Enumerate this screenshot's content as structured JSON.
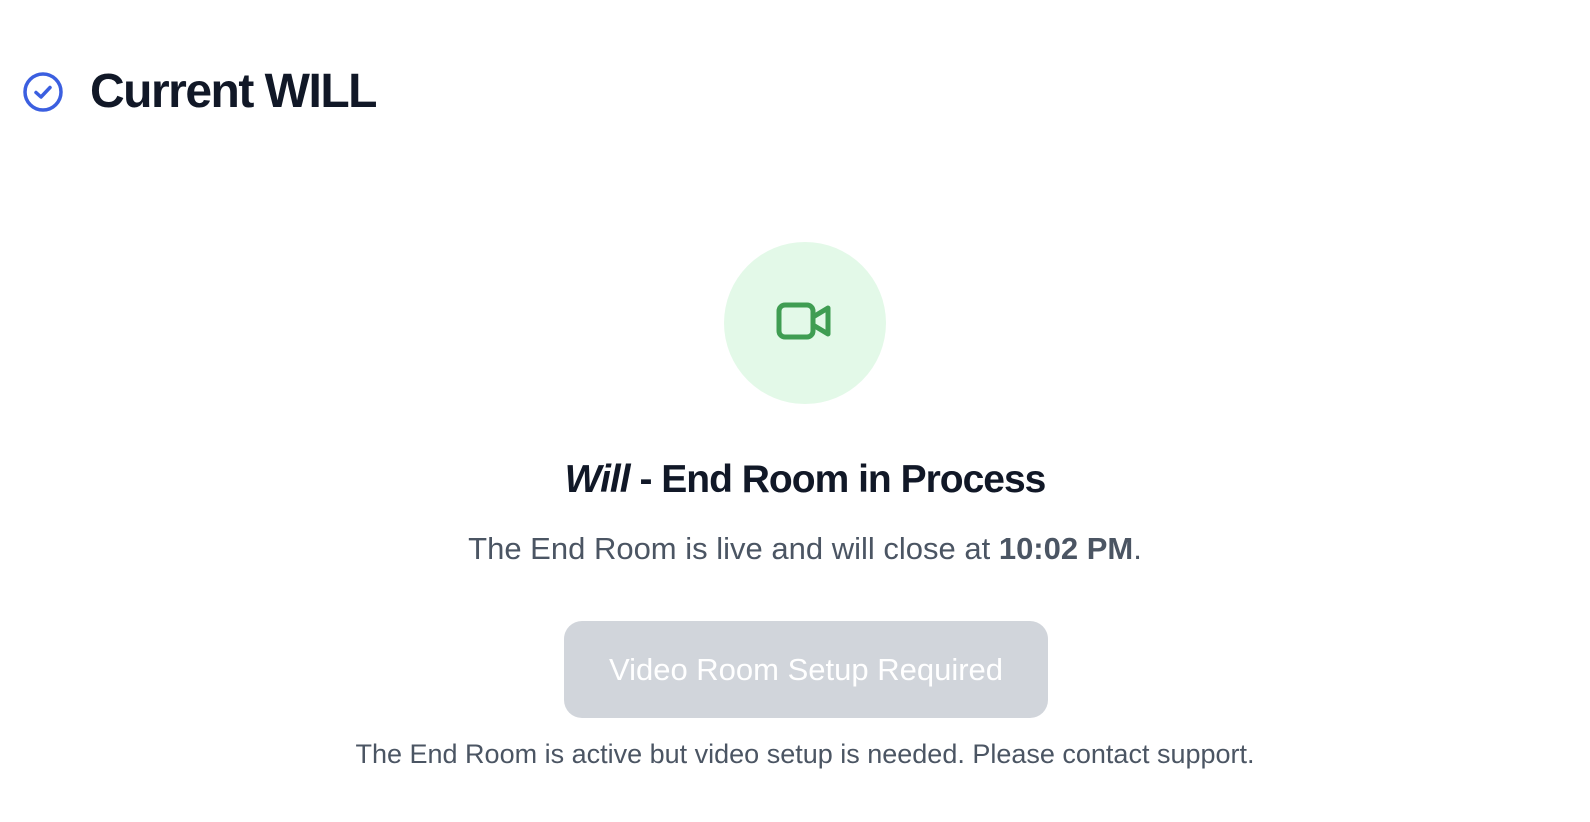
{
  "header": {
    "title": "Current WILL",
    "icon": "check-circle-icon",
    "icon_color": "#3b5fe0"
  },
  "room": {
    "icon": "video-camera-icon",
    "icon_color": "#3f9d52",
    "circle_color": "#e3f9e8",
    "title_italic": "Will",
    "title_rest": " - End Room in Process",
    "status_prefix": "The End Room is live and will close at ",
    "close_time": "10:02 PM",
    "status_suffix": ".",
    "button_label": "Video Room Setup Required",
    "button_color": "#d1d5db",
    "note": "The End Room is active but video setup is needed. Please contact support."
  }
}
